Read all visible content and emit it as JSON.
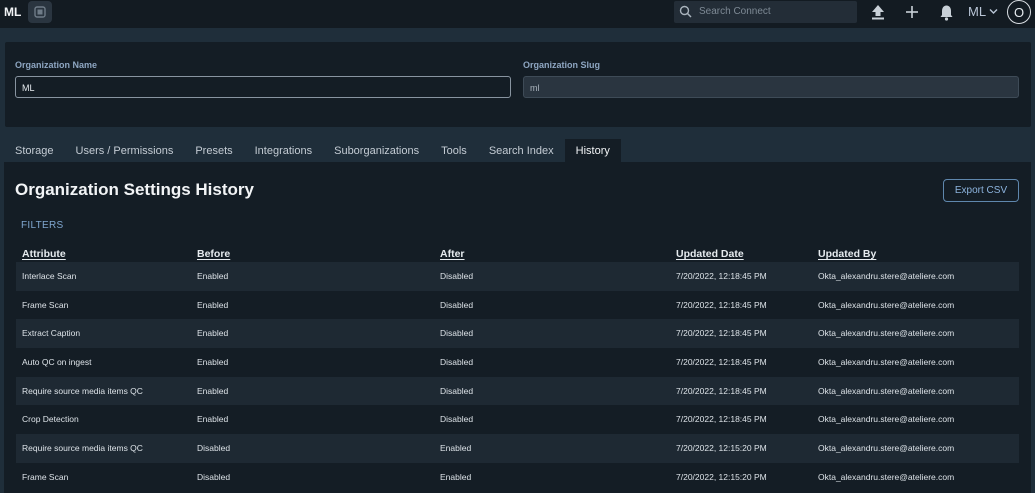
{
  "topbar": {
    "brand": "ML",
    "search_placeholder": "Search Connect",
    "user_label": "ML",
    "avatar_initial": "O"
  },
  "org": {
    "name_label": "Organization Name",
    "name_value": "ML",
    "slug_label": "Organization Slug",
    "slug_value": "ml"
  },
  "tabs": [
    {
      "label": "Storage"
    },
    {
      "label": "Users / Permissions"
    },
    {
      "label": "Presets"
    },
    {
      "label": "Integrations"
    },
    {
      "label": "Suborganizations"
    },
    {
      "label": "Tools"
    },
    {
      "label": "Search Index"
    },
    {
      "label": "History",
      "active": true
    }
  ],
  "history": {
    "title": "Organization Settings History",
    "export_label": "Export CSV",
    "filters_label": "FILTERS",
    "columns": [
      "Attribute",
      "Before",
      "After",
      "Updated Date",
      "Updated By"
    ],
    "rows": [
      [
        "Interlace Scan",
        "Enabled",
        "Disabled",
        "7/20/2022, 12:18:45 PM",
        "Okta_alexandru.stere@ateliere.com"
      ],
      [
        "Frame Scan",
        "Enabled",
        "Disabled",
        "7/20/2022, 12:18:45 PM",
        "Okta_alexandru.stere@ateliere.com"
      ],
      [
        "Extract Caption",
        "Enabled",
        "Disabled",
        "7/20/2022, 12:18:45 PM",
        "Okta_alexandru.stere@ateliere.com"
      ],
      [
        "Auto QC on ingest",
        "Enabled",
        "Disabled",
        "7/20/2022, 12:18:45 PM",
        "Okta_alexandru.stere@ateliere.com"
      ],
      [
        "Require source media items QC",
        "Enabled",
        "Disabled",
        "7/20/2022, 12:18:45 PM",
        "Okta_alexandru.stere@ateliere.com"
      ],
      [
        "Crop Detection",
        "Enabled",
        "Disabled",
        "7/20/2022, 12:18:45 PM",
        "Okta_alexandru.stere@ateliere.com"
      ],
      [
        "Require source media items QC",
        "Disabled",
        "Enabled",
        "7/20/2022, 12:15:20 PM",
        "Okta_alexandru.stere@ateliere.com"
      ],
      [
        "Frame Scan",
        "Disabled",
        "Enabled",
        "7/20/2022, 12:15:20 PM",
        "Okta_alexandru.stere@ateliere.com"
      ]
    ]
  },
  "icons": [
    "app-icon",
    "search-icon",
    "upload-icon",
    "plus-icon",
    "bell-icon",
    "chevron-down-icon"
  ],
  "colors": {
    "accent": "#7fa6cf",
    "background": "#1f2e3a",
    "surface": "#141d25"
  }
}
